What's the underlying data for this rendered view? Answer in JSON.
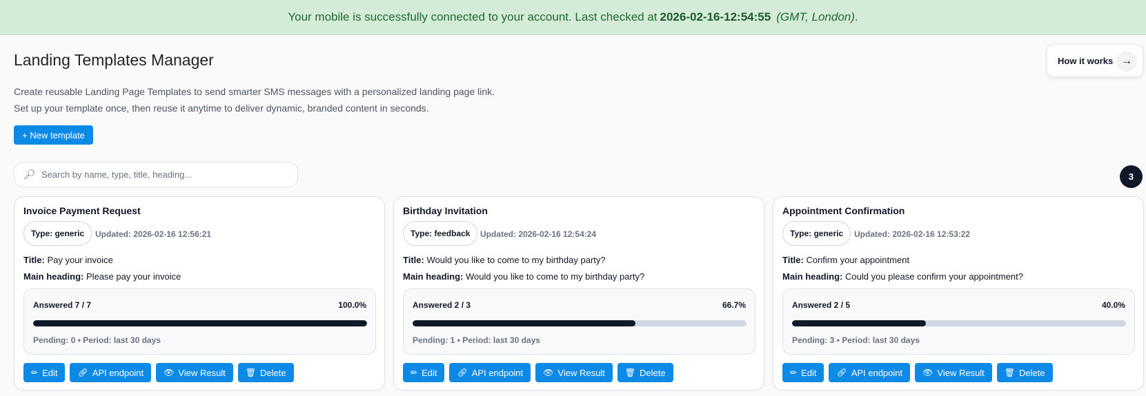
{
  "banner": {
    "prefix": "Your mobile is successfully connected to your account. Last checked at",
    "timestamp": "2026-02-16-12:54:55",
    "timezone": "(GMT, London)",
    "suffix": "."
  },
  "header": {
    "title": "Landing Templates Manager",
    "how_it_works_label": "How it works",
    "how_it_works_icon": "arrow-right-icon",
    "description_line1": "Create reusable Landing Page Templates to send smarter SMS messages with a personalized landing page link.",
    "description_line2": "Set up your template once, then reuse it anytime to deliver dynamic, branded content in seconds.",
    "new_template_label": "+ New template"
  },
  "search": {
    "placeholder": "Search by name, type, title, heading...",
    "value": "",
    "icon": "search-icon"
  },
  "template_count": "3",
  "labels": {
    "title": "Title:",
    "main_heading": "Main heading:",
    "edit": "Edit",
    "api": "API endpoint",
    "view": "View Result",
    "delete": "Delete"
  },
  "colors": {
    "banner_bg": "#d4ebd8",
    "primary": "#0d8ae5",
    "progress": "#111827",
    "track": "#d1d7e0"
  },
  "templates": [
    {
      "name": "Invoice Payment Request",
      "type": "Type: generic",
      "updated": "Updated: 2026-02-16 12:56:21",
      "title": "Pay your invoice",
      "main_heading": "Please pay your invoice",
      "answered": "Answered 7 / 7",
      "percent_label": "100.0%",
      "progress": 1.0,
      "pending": "Pending: 0 • Period: last 30 days"
    },
    {
      "name": "Birthday Invitation",
      "type": "Type: feedback",
      "updated": "Updated: 2026-02-16 12:54:24",
      "title": "Would you like to come to my birthday party?",
      "main_heading": "Would you like to come to my birthday party?",
      "answered": "Answered 2 / 3",
      "percent_label": "66.7%",
      "progress": 0.667,
      "pending": "Pending: 1 • Period: last 30 days"
    },
    {
      "name": "Appointment Confirmation",
      "type": "Type: generic",
      "updated": "Updated: 2026-02-16 12:53:22",
      "title": "Confirm your appointment",
      "main_heading": "Could you please confirm your appointment?",
      "answered": "Answered 2 / 5",
      "percent_label": "40.0%",
      "progress": 0.4,
      "pending": "Pending: 3 • Period: last 30 days"
    }
  ]
}
